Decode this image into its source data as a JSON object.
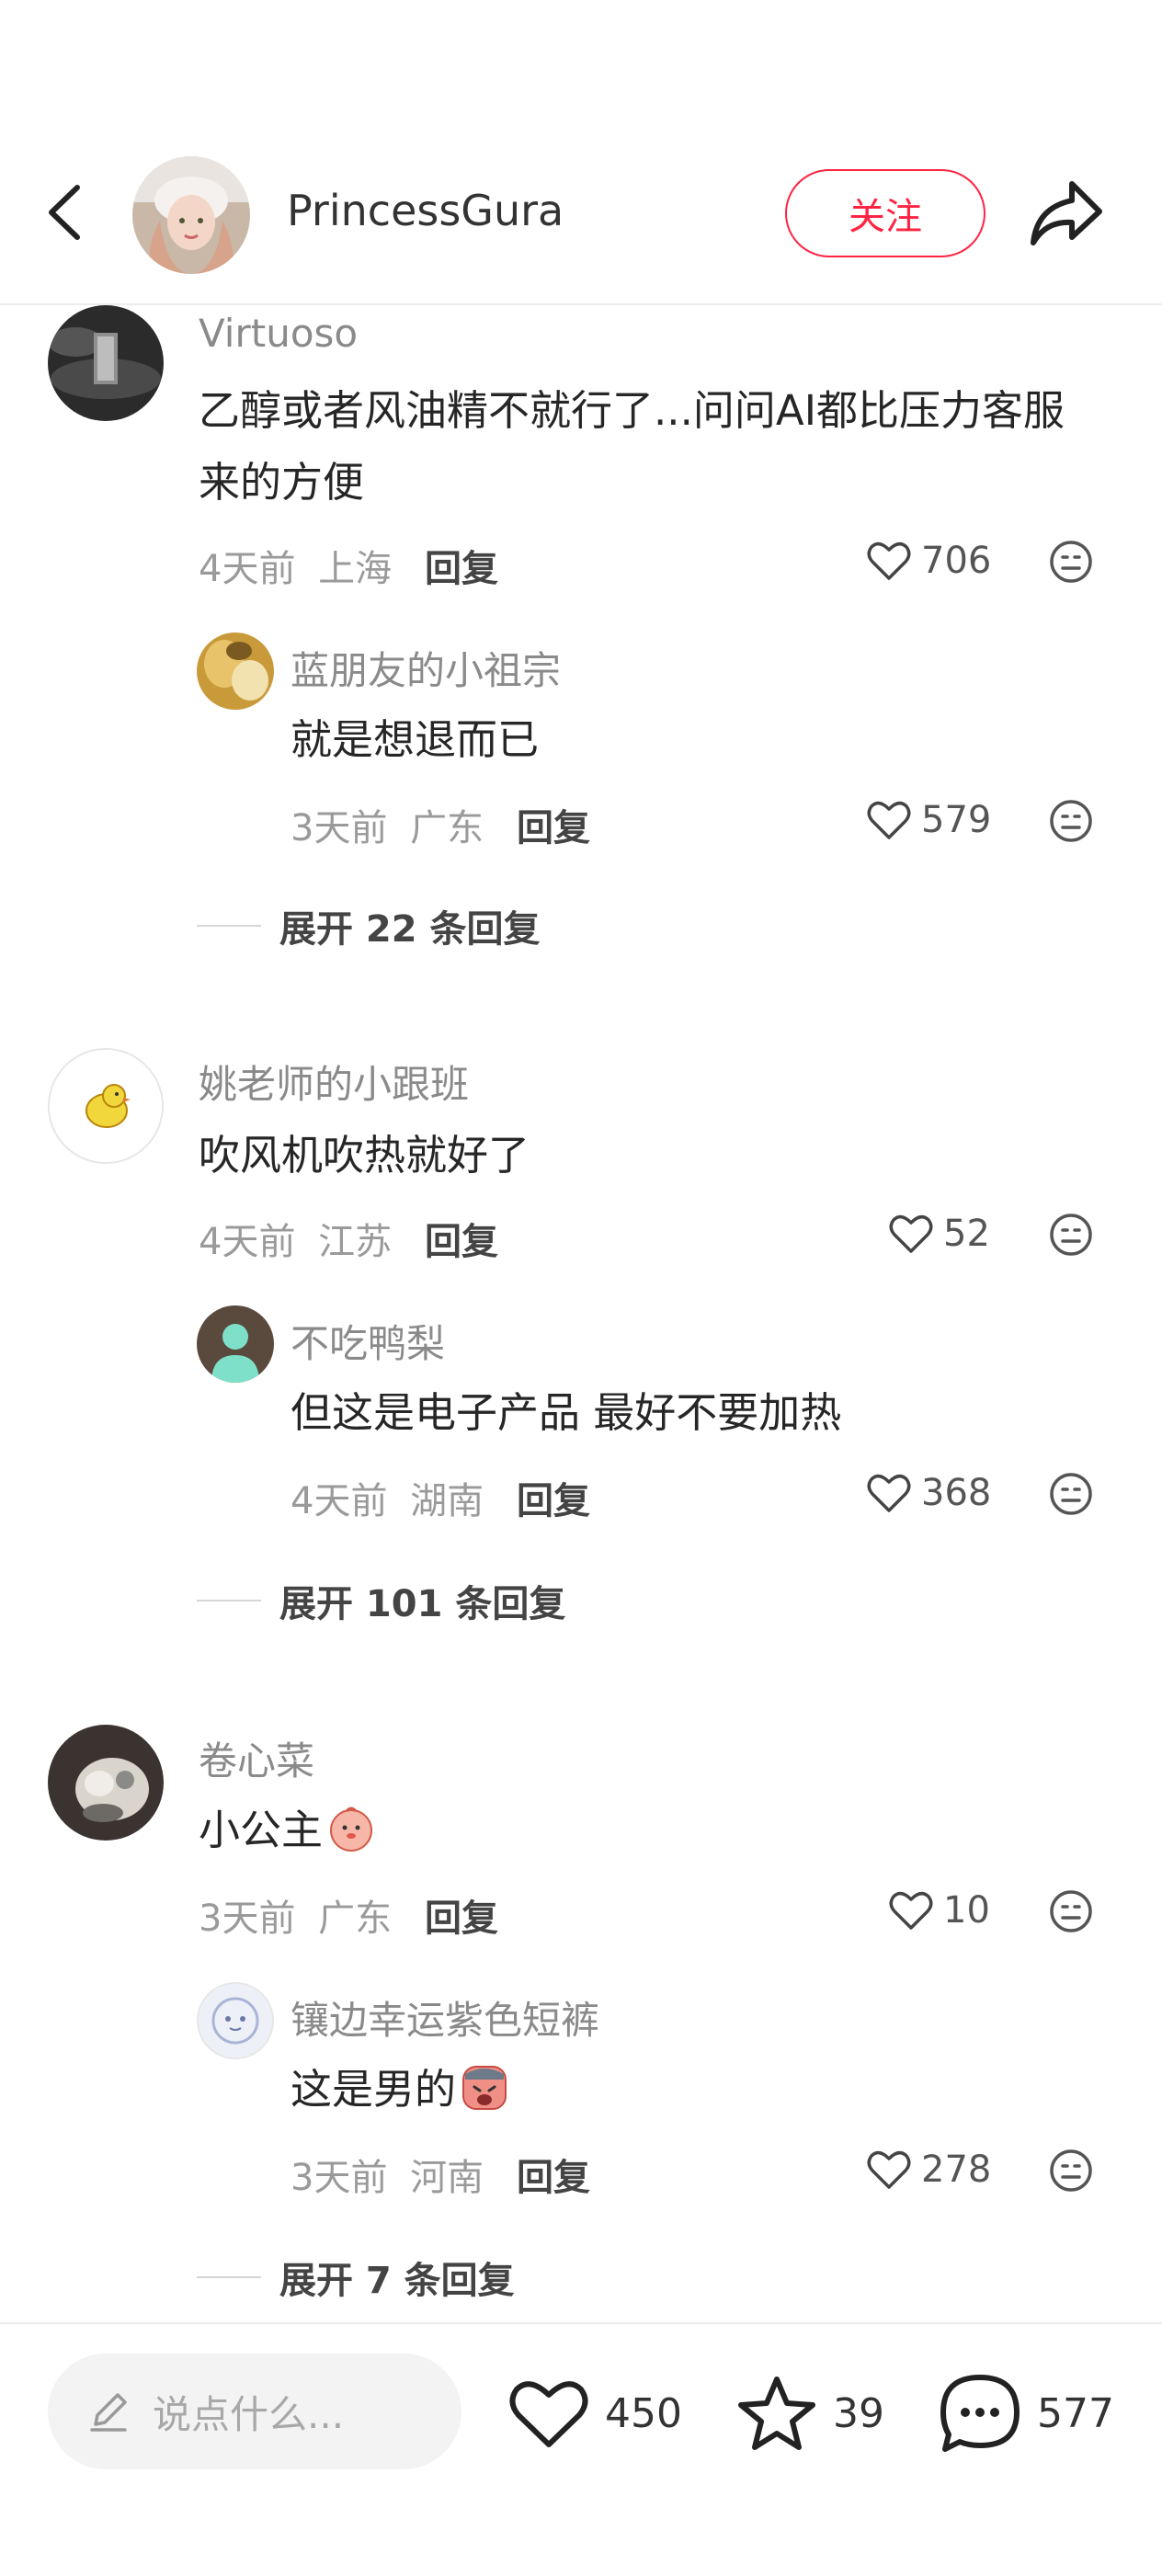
{
  "header": {
    "author_name": "PrincessGura",
    "follow_label": "关注"
  },
  "comments": [
    {
      "user": "Virtuoso",
      "text": "乙醇或者风油精不就行了...问问AI都比压力客服来的方便",
      "time": "4天前",
      "location": "上海",
      "reply_label": "回复",
      "likes": "706",
      "sub": {
        "user": "蓝朋友的小祖宗",
        "text": "就是想退而已",
        "time": "3天前",
        "location": "广东",
        "reply_label": "回复",
        "likes": "579"
      },
      "expand_label": "展开 22 条回复"
    },
    {
      "user": "姚老师的小跟班",
      "text": "吹风机吹热就好了",
      "time": "4天前",
      "location": "江苏",
      "reply_label": "回复",
      "likes": "52",
      "sub": {
        "user": "不吃鸭梨",
        "text": "但这是电子产品 最好不要加热",
        "time": "4天前",
        "location": "湖南",
        "reply_label": "回复",
        "likes": "368"
      },
      "expand_label": "展开 101 条回复"
    },
    {
      "user": "卷心菜",
      "text": "小公主",
      "time": "3天前",
      "location": "广东",
      "reply_label": "回复",
      "likes": "10",
      "sub": {
        "user": "镶边幸运紫色短裤",
        "text": "这是男的",
        "time": "3天前",
        "location": "河南",
        "reply_label": "回复",
        "likes": "278"
      },
      "expand_label": "展开 7 条回复"
    }
  ],
  "bottom_bar": {
    "input_placeholder": "说点什么...",
    "like_count": "450",
    "collect_count": "39",
    "comment_count": "577"
  },
  "colors": {
    "accent": "#ff2442",
    "meta_gray": "#9a9a9a",
    "name_gray": "#8a8a8a"
  },
  "icons": [
    "back-arrow-icon",
    "share-icon",
    "heart-icon",
    "emoji-face-icon",
    "pencil-icon",
    "star-icon",
    "comment-bubble-icon"
  ]
}
